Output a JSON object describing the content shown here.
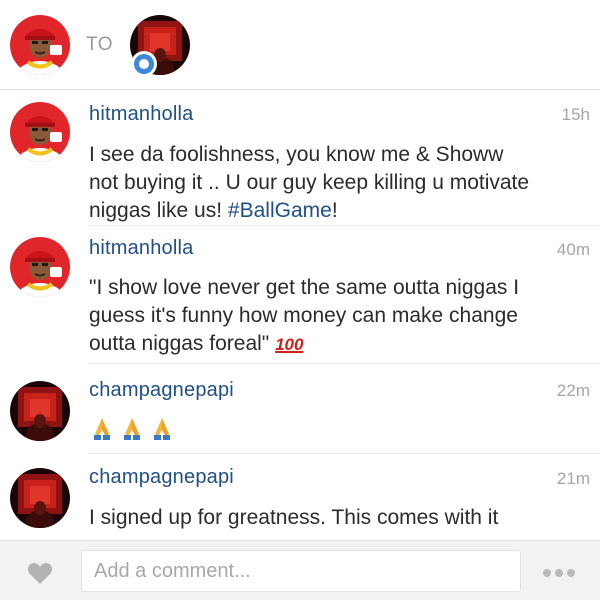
{
  "header": {
    "to_label": "TO"
  },
  "comments": [
    {
      "username": "hitmanholla",
      "time": "15h",
      "text_lines": [
        "I see da foolishness, you know me & Showw",
        "not buying it .. U our guy keep killing u motivate",
        "niggas like us! "
      ],
      "hashtag": "#BallGame",
      "text_tail": "!"
    },
    {
      "username": "hitmanholla",
      "time": "40m",
      "text_lines": [
        "\"I show love never get the same outta niggas I",
        "guess it's funny how money can make change",
        "outta niggas foreal\" "
      ],
      "emoji_100": "100"
    },
    {
      "username": "champagnepapi",
      "time": "22m"
    },
    {
      "username": "champagnepapi",
      "time": "21m",
      "text_lines": [
        "I signed up for greatness. This comes with it"
      ]
    }
  ],
  "composer": {
    "placeholder": "Add a comment..."
  },
  "icons": {
    "like": "heart-icon",
    "more": "more-options-icon",
    "reaction": "folded-hands-icon",
    "badge": "ring-badge-icon"
  },
  "colors": {
    "username": "#1e4f87",
    "badge": "#3d87d8",
    "emoji_100": "#d0201b"
  }
}
